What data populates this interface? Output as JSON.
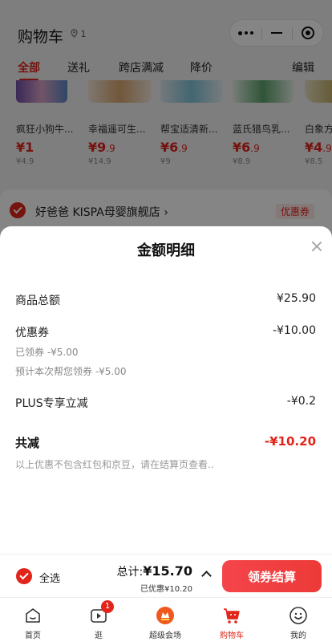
{
  "header": {
    "title": "购物车",
    "location": "1"
  },
  "tabs": [
    "全部",
    "送礼",
    "跨店满减",
    "降价"
  ],
  "edit_label": "编辑",
  "products": [
    {
      "name": "疯狂小狗牛...",
      "price_int": "¥1",
      "price_dec": "",
      "orig": "¥4.9"
    },
    {
      "name": "幸福遥可生...",
      "price_int": "¥9",
      "price_dec": ".9",
      "orig": "¥14.9"
    },
    {
      "name": "帮宝适清新...",
      "price_int": "¥6",
      "price_dec": ".9",
      "orig": "¥9"
    },
    {
      "name": "蓝氏猎鸟乳...",
      "price_int": "¥6",
      "price_dec": ".9",
      "orig": "¥8.9"
    },
    {
      "name": "白象方",
      "price_int": "¥4",
      "price_dec": ".9",
      "orig": "¥8.5"
    }
  ],
  "shop": {
    "name": "好爸爸 KISPA母婴旗舰店 ›",
    "tag": "优惠券"
  },
  "sheet": {
    "title": "金额明细",
    "goods_total_label": "商品总额",
    "goods_total_value": "¥25.90",
    "coupon_label": "优惠券",
    "coupon_value": "-¥10.00",
    "coupon_claimed": "已领券 -¥5.00",
    "coupon_estimate": "预计本次帮您领券 -¥5.00",
    "plus_label": "PLUS专享立减",
    "plus_value": "-¥0.2",
    "total_reduce_label": "共减",
    "total_reduce_value": "-¥10.20",
    "note": "以上优惠不包含红包和京豆，请在结算页查看.."
  },
  "checkout": {
    "select_all": "全选",
    "total_prefix": "总计:",
    "total_value": "¥15.70",
    "discount": "已优惠¥10.20",
    "button": "领券结算"
  },
  "tabbar": [
    {
      "label": "首页",
      "icon": "home-icon"
    },
    {
      "label": "逛",
      "icon": "play-icon",
      "badge": "1"
    },
    {
      "label": "超级会场",
      "icon": "venue-icon"
    },
    {
      "label": "购物车",
      "icon": "cart-icon",
      "active": true
    },
    {
      "label": "我的",
      "icon": "smiley-icon"
    }
  ],
  "colors": {
    "accent": "#e1251b",
    "button": "#f5454b"
  }
}
